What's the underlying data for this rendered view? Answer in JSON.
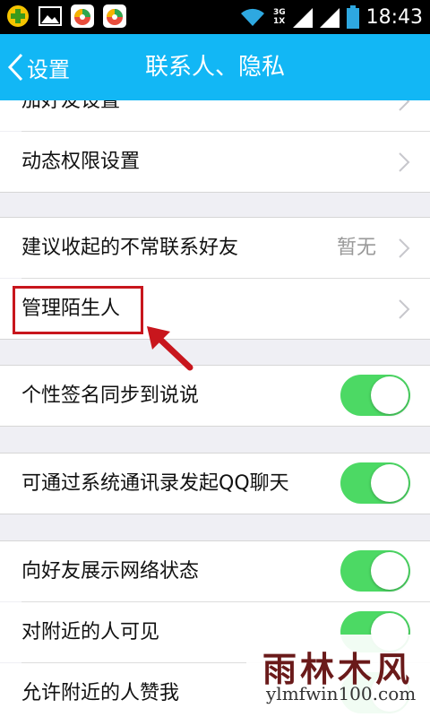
{
  "status_bar": {
    "time": "18:43",
    "network": [
      "3G",
      "1X"
    ]
  },
  "header": {
    "back_label": "设置",
    "title": "联系人、隐私"
  },
  "rows": {
    "add_friend": {
      "label": "加好友设置"
    },
    "dynamic_permission": {
      "label": "动态权限设置"
    },
    "suggest_collapse": {
      "label": "建议收起的不常联系好友",
      "value": "暂无"
    },
    "manage_strangers": {
      "label": "管理陌生人"
    },
    "signature_sync": {
      "label": "个性签名同步到说说",
      "toggle": true
    },
    "qq_chat_contacts": {
      "label": "可通过系统通讯录发起QQ聊天",
      "toggle": true
    },
    "show_network": {
      "label": "向好友展示网络状态",
      "toggle": true
    },
    "visible_nearby": {
      "label": "对附近的人可见",
      "toggle": true
    },
    "allow_nearby_like": {
      "label": "允许附近的人赞我",
      "toggle": true
    }
  },
  "colors": {
    "header": "#12b7f5",
    "toggle_on": "#4cd964",
    "highlight": "#c8161d"
  },
  "watermark": {
    "cn": "雨林木风",
    "url": "ylmfwin100.com"
  }
}
